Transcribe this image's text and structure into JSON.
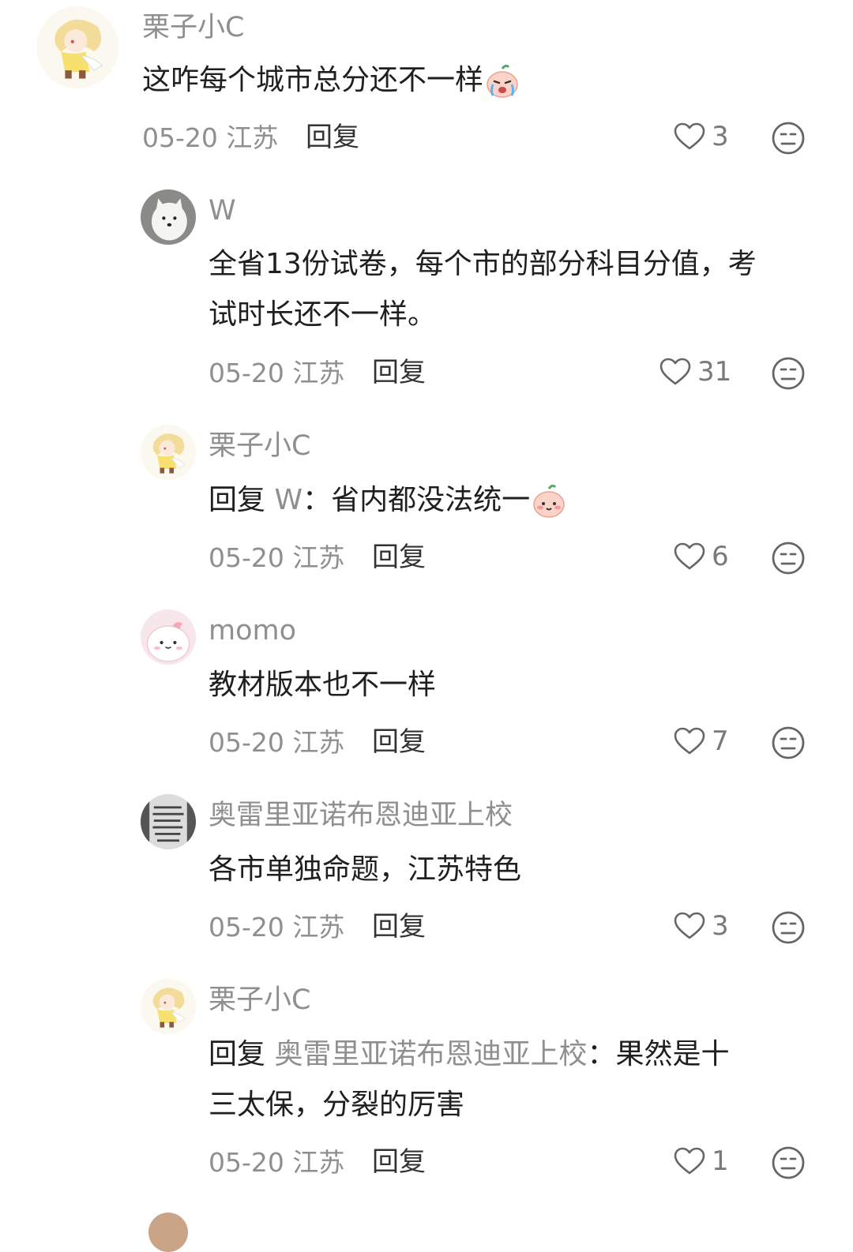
{
  "comments": [
    {
      "user": "栗子小C",
      "text": "这咋每个城市总分还不一样",
      "date": "05-20",
      "location": "江苏",
      "reply_label": "回复",
      "likes": "3",
      "emoji": "crying-emoji"
    },
    {
      "user": "W",
      "text_line1": "全省13份试卷，每个市的部分科目分值，考",
      "text_line2": "试时长还不一样。",
      "date": "05-20",
      "location": "江苏",
      "reply_label": "回复",
      "likes": "31"
    },
    {
      "user": "栗子小C",
      "reply_prefix": "回复",
      "mention": "W",
      "text": "：省内都没法统一",
      "date": "05-20",
      "location": "江苏",
      "reply_label": "回复",
      "likes": "6",
      "emoji": "blush-emoji"
    },
    {
      "user": "momo",
      "text": "教材版本也不一样",
      "date": "05-20",
      "location": "江苏",
      "reply_label": "回复",
      "likes": "7"
    },
    {
      "user": "奥雷里亚诺布恩迪亚上校",
      "text": "各市单独命题，江苏特色",
      "date": "05-20",
      "location": "江苏",
      "reply_label": "回复",
      "likes": "3"
    },
    {
      "user": "栗子小C",
      "reply_prefix": "回复",
      "mention": "奥雷里亚诺布恩迪亚上校",
      "text_line1": "：果然是十",
      "text_line2": "三太保，分裂的厉害",
      "date": "05-20",
      "location": "江苏",
      "reply_label": "回复",
      "likes": "1"
    }
  ],
  "icons": {
    "like": "heart-outline-icon",
    "dislike": "meh-face-icon"
  },
  "colors": {
    "username": "#8f8f8f",
    "text": "#1f1f1f",
    "meta": "#8f8f8f",
    "icon": "#666666"
  }
}
